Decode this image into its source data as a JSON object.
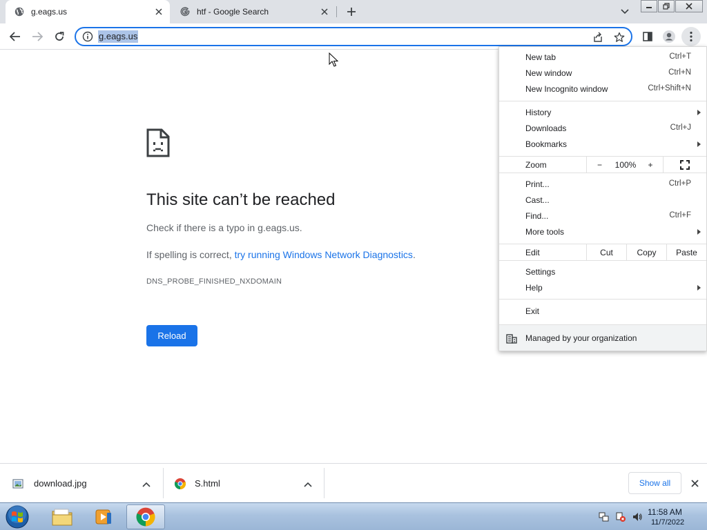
{
  "tabs": [
    {
      "title": "g.eags.us",
      "favicon": "globe-icon",
      "active": true
    },
    {
      "title": "htf - Google Search",
      "favicon": "google-icon",
      "active": false
    }
  ],
  "omnibox": {
    "url": "g.eags.us"
  },
  "error": {
    "title": "This site can’t be reached",
    "line1": "Check if there is a typo in g.eags.us.",
    "line2_prefix": "If spelling is correct, ",
    "line2_link": "try running Windows Network Diagnostics",
    "line2_suffix": ".",
    "code": "DNS_PROBE_FINISHED_NXDOMAIN",
    "reload_label": "Reload"
  },
  "menu": {
    "new_tab": {
      "label": "New tab",
      "shortcut": "Ctrl+T"
    },
    "new_window": {
      "label": "New window",
      "shortcut": "Ctrl+N"
    },
    "new_incognito": {
      "label": "New Incognito window",
      "shortcut": "Ctrl+Shift+N"
    },
    "history": {
      "label": "History"
    },
    "downloads": {
      "label": "Downloads",
      "shortcut": "Ctrl+J"
    },
    "bookmarks": {
      "label": "Bookmarks"
    },
    "zoom": {
      "label": "Zoom",
      "minus": "−",
      "value": "100%",
      "plus": "+"
    },
    "print": {
      "label": "Print...",
      "shortcut": "Ctrl+P"
    },
    "cast": {
      "label": "Cast..."
    },
    "find": {
      "label": "Find...",
      "shortcut": "Ctrl+F"
    },
    "more_tools": {
      "label": "More tools"
    },
    "edit": {
      "label": "Edit",
      "cut": "Cut",
      "copy": "Copy",
      "paste": "Paste"
    },
    "settings": {
      "label": "Settings"
    },
    "help": {
      "label": "Help"
    },
    "exit": {
      "label": "Exit"
    },
    "managed": {
      "label": "Managed by your organization"
    }
  },
  "downloads": [
    {
      "name": "download.jpg",
      "icon": "image-file-icon"
    },
    {
      "name": "S.html",
      "icon": "chrome-file-icon"
    }
  ],
  "shelf": {
    "show_all": "Show all"
  },
  "taskbar": {
    "time": "11:58 AM",
    "date": "11/7/2022"
  },
  "colors": {
    "accent": "#1a73e8",
    "tabstrip": "#dee1e6",
    "selection": "#acc4e8"
  }
}
